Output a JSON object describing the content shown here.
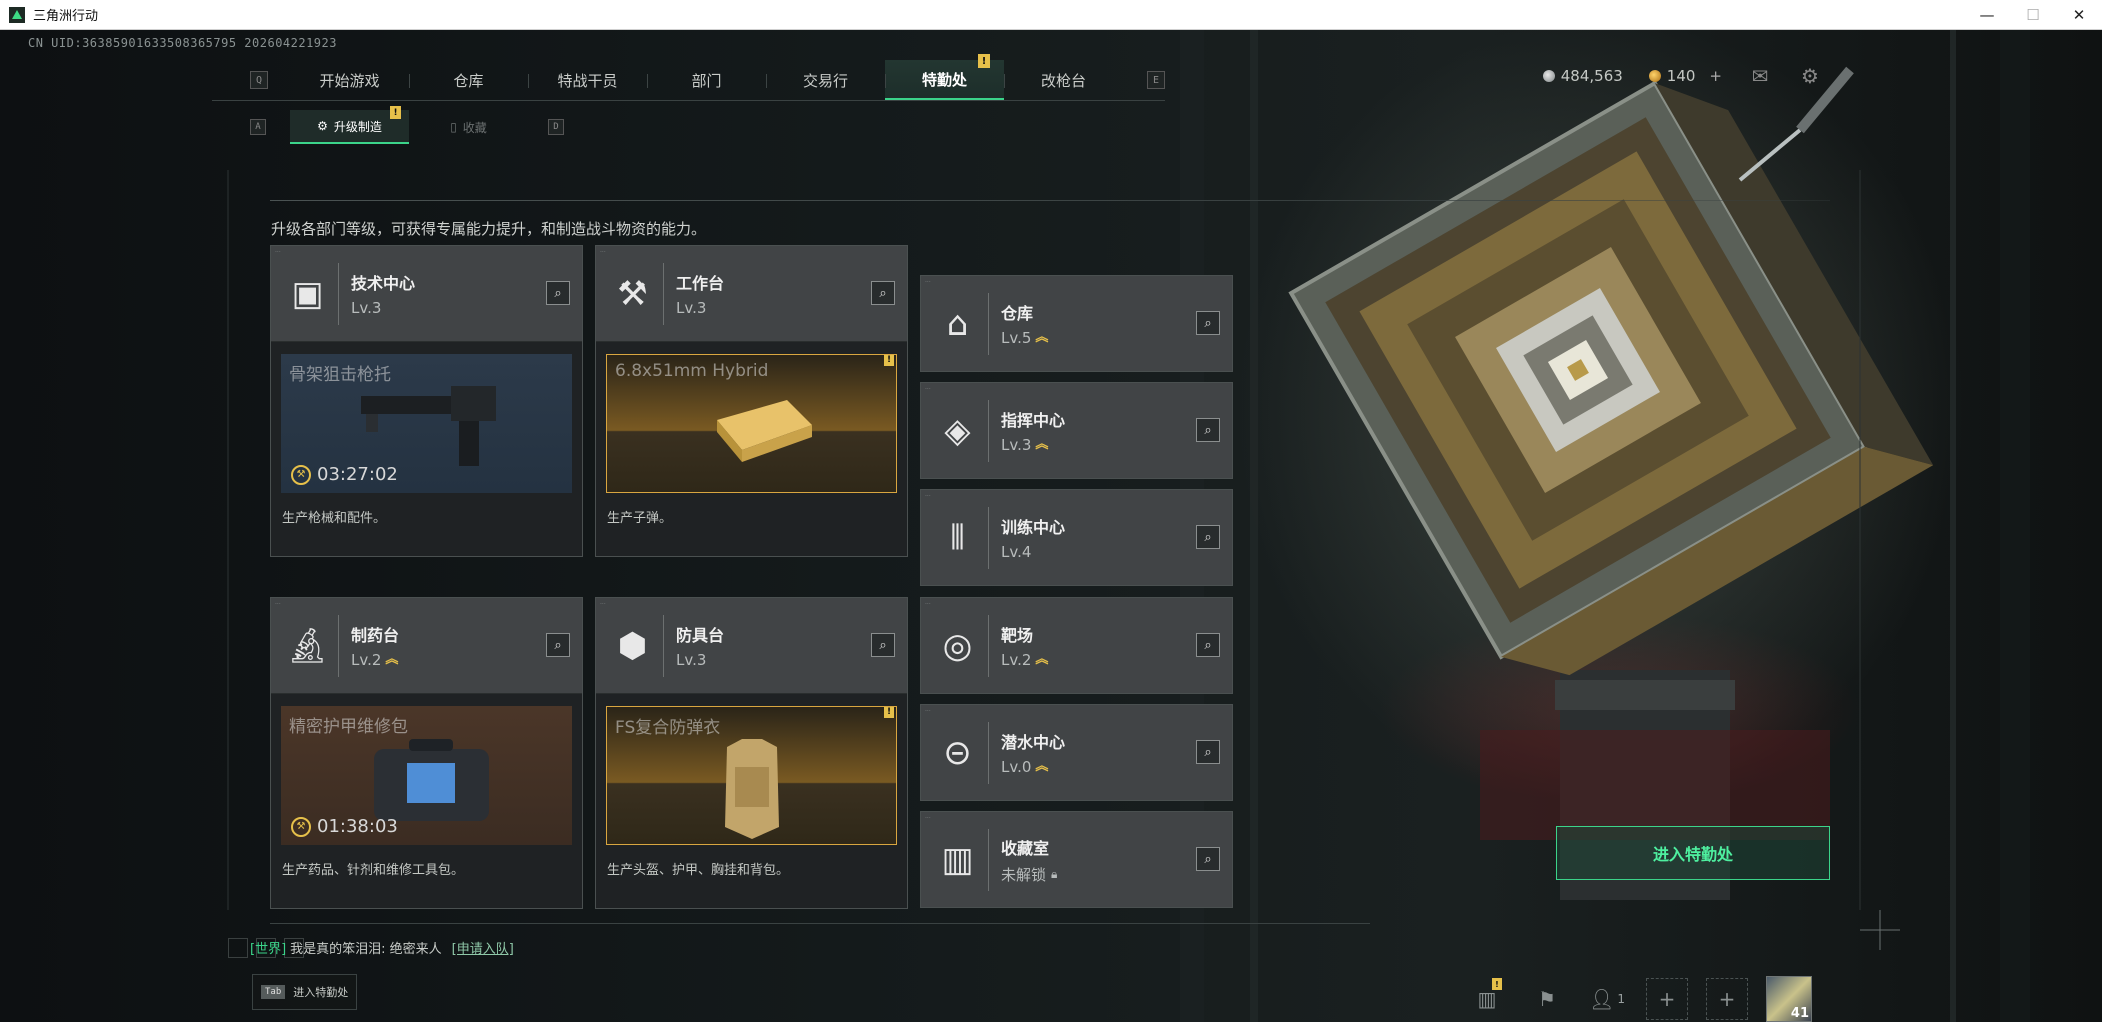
{
  "window": {
    "title": "三角洲行动",
    "controls": {
      "minimize": "—",
      "maximize": "☐",
      "close": "✕"
    }
  },
  "uid": "CN UID:36385901633508365795 202604221923",
  "topnav": {
    "key_left": "Q",
    "key_right": "E",
    "tabs": [
      {
        "label": "开始游戏"
      },
      {
        "label": "仓库"
      },
      {
        "label": "特战干员"
      },
      {
        "label": "部门"
      },
      {
        "label": "交易行"
      },
      {
        "label": "特勤处",
        "active": true,
        "alert": "!"
      },
      {
        "label": "改枪台"
      }
    ]
  },
  "subnav": {
    "key_left": "A",
    "key_right": "D",
    "tabs": [
      {
        "label": "升级制造",
        "active": true,
        "alert": "!"
      },
      {
        "label": "收藏"
      }
    ]
  },
  "currency": {
    "silver": "484,563",
    "gold": "140",
    "plus": "+"
  },
  "description": "升级各部门等级，可获得专属能力提升，和制造战斗物资的能力。",
  "departments": [
    {
      "name": "技术中心",
      "level": "Lv.3",
      "icon": "tech-center-icon"
    },
    {
      "name": "工作台",
      "level": "Lv.3",
      "icon": "workbench-icon"
    },
    {
      "name": "仓库",
      "level": "Lv.5",
      "icon": "warehouse-icon",
      "upgradable": true
    },
    {
      "name": "指挥中心",
      "level": "Lv.3",
      "icon": "command-center-icon",
      "upgradable": true
    },
    {
      "name": "训练中心",
      "level": "Lv.4",
      "icon": "training-center-icon"
    },
    {
      "name": "制药台",
      "level": "Lv.2",
      "icon": "pharmacy-icon",
      "upgradable": true
    },
    {
      "name": "防具台",
      "level": "Lv.3",
      "icon": "armor-bench-icon"
    },
    {
      "name": "靶场",
      "level": "Lv.2",
      "icon": "shooting-range-icon",
      "upgradable": true
    },
    {
      "name": "潜水中心",
      "level": "Lv.0",
      "icon": "diving-center-icon",
      "upgradable": true
    },
    {
      "name": "收藏室",
      "level": "未解锁",
      "icon": "collection-room-icon",
      "locked": true
    }
  ],
  "productions": [
    {
      "item": "骨架狙击枪托",
      "timer": "03:27:02",
      "desc": "生产枪械和配件。"
    },
    {
      "item": "6.8x51mm Hybrid",
      "alert": "!",
      "desc": "生产子弹。"
    },
    {
      "item": "精密护甲维修包",
      "timer": "01:38:03",
      "desc": "生产药品、针剂和维修工具包。"
    },
    {
      "item": "FS复合防弹衣",
      "alert": "!",
      "desc": "生产头盔、护甲、胸挂和背包。"
    }
  ],
  "enter_button": "进入特勤处",
  "chat": {
    "channel": "[世界]",
    "message": "我是真的笨泪泪: 绝密来人",
    "link": "[申请入队]"
  },
  "tab_hint": {
    "key": "Tab",
    "label": "进入特勤处"
  },
  "bottom": {
    "team_count": "1",
    "player_level": "41",
    "stats_alert": "!"
  },
  "colors": {
    "accent_green": "#3bd48a",
    "alert_yellow": "#e6c04a"
  }
}
